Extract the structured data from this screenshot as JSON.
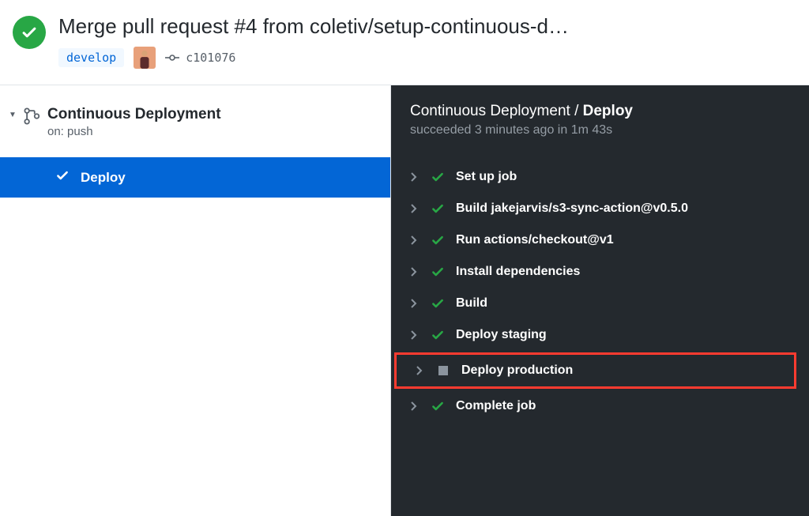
{
  "header": {
    "title": "Merge pull request #4 from coletiv/setup-continuous-d…",
    "branch": "develop",
    "commit_sha": "c101076"
  },
  "workflow": {
    "name": "Continuous Deployment",
    "trigger": "on: push",
    "jobs": [
      {
        "name": "Deploy",
        "selected": true
      }
    ]
  },
  "detail": {
    "breadcrumb_parent": "Continuous Deployment",
    "breadcrumb_current": "Deploy",
    "status": "succeeded 3 minutes ago in 1m 43s",
    "steps": [
      {
        "label": "Set up job",
        "status": "success"
      },
      {
        "label": "Build jakejarvis/s3-sync-action@v0.5.0",
        "status": "success"
      },
      {
        "label": "Run actions/checkout@v1",
        "status": "success"
      },
      {
        "label": "Install dependencies",
        "status": "success"
      },
      {
        "label": "Build",
        "status": "success"
      },
      {
        "label": "Deploy staging",
        "status": "success"
      },
      {
        "label": "Deploy production",
        "status": "skipped",
        "highlighted": true
      },
      {
        "label": "Complete job",
        "status": "success"
      }
    ]
  }
}
